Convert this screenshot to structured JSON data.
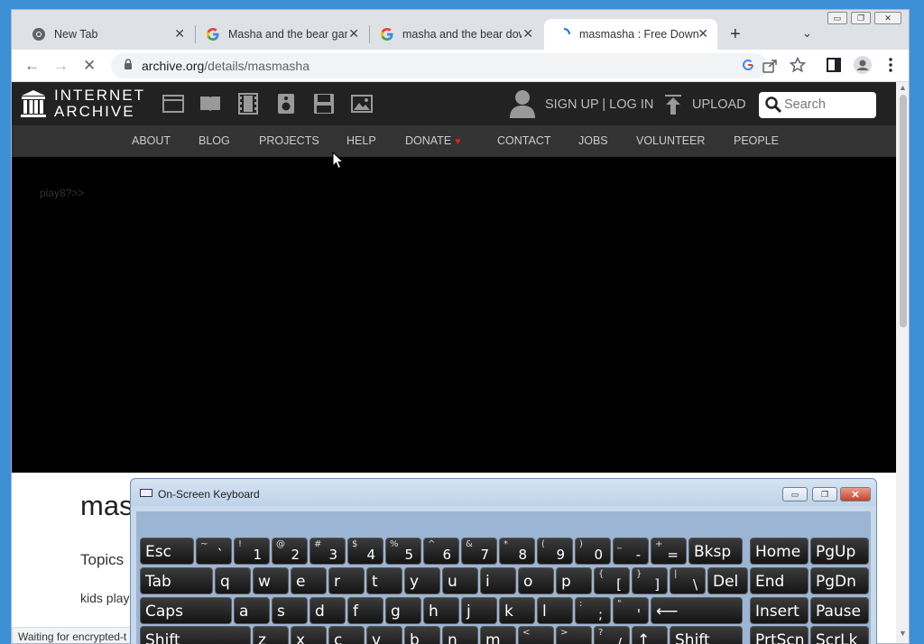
{
  "browser": {
    "tabs": [
      {
        "title": "New Tab",
        "icon": "chrome-icon",
        "active": false
      },
      {
        "title": "Masha and the bear gam",
        "icon": "google-icon",
        "active": false
      },
      {
        "title": "masha and the bear dow",
        "icon": "google-icon",
        "active": false
      },
      {
        "title": "masmasha : Free Downlo",
        "icon": "loading-icon",
        "active": true
      }
    ],
    "close_glyph": "✕",
    "new_tab_glyph": "+",
    "tab_search_glyph": "⌄",
    "window_controls": {
      "minimize": "▭",
      "restore": "❐",
      "close": "✕"
    },
    "nav": {
      "back": "←",
      "forward": "→",
      "stop": "✕"
    },
    "url_domain": "archive.org",
    "url_path": "/details/masmasha",
    "toolbar_icons": [
      "google-lens-icon",
      "share-icon",
      "star-icon",
      "sidepanel-icon",
      "profile-icon",
      "menu-icon"
    ]
  },
  "ia_header": {
    "wordmark_line1": "INTERNET",
    "wordmark_line2": "ARCHIVE",
    "media_icons": [
      "web-icon",
      "texts-icon",
      "video-icon",
      "audio-icon",
      "software-icon",
      "images-icon"
    ],
    "signup_login": "SIGN UP | LOG IN",
    "upload": "UPLOAD",
    "search_placeholder": "Search"
  },
  "ia_nav": {
    "items": [
      "ABOUT",
      "BLOG",
      "PROJECTS",
      "HELP",
      "DONATE",
      "CONTACT",
      "JOBS",
      "VOLUNTEER",
      "PEOPLE"
    ],
    "donate_heart": "♥"
  },
  "player": {
    "text": "play8?>>"
  },
  "item": {
    "title": "mas",
    "topics_label": "Topics",
    "topics_value": "kids play"
  },
  "status_bar": {
    "text": "Waiting for encrypted-t"
  },
  "osk": {
    "title": "On-Screen Keyboard",
    "controls": {
      "minimize": "▭",
      "restore": "❐",
      "close": "✕"
    },
    "rows": [
      [
        {
          "main": "Esc"
        },
        {
          "shift": "~",
          "low": "`"
        },
        {
          "shift": "!",
          "low": "1"
        },
        {
          "shift": "@",
          "low": "2"
        },
        {
          "shift": "#",
          "low": "3"
        },
        {
          "shift": "$",
          "low": "4"
        },
        {
          "shift": "%",
          "low": "5"
        },
        {
          "shift": "^",
          "low": "6"
        },
        {
          "shift": "&",
          "low": "7"
        },
        {
          "shift": "*",
          "low": "8"
        },
        {
          "shift": "(",
          "low": "9"
        },
        {
          "shift": ")",
          "low": "0"
        },
        {
          "shift": "_",
          "low": "-"
        },
        {
          "shift": "+",
          "low": "="
        },
        {
          "main": "Bksp"
        },
        {
          "main": "Home"
        },
        {
          "main": "PgUp"
        }
      ],
      [
        {
          "main": "Tab"
        },
        {
          "main": "q"
        },
        {
          "main": "w"
        },
        {
          "main": "e"
        },
        {
          "main": "r"
        },
        {
          "main": "t"
        },
        {
          "main": "y"
        },
        {
          "main": "u"
        },
        {
          "main": "i"
        },
        {
          "main": "o"
        },
        {
          "main": "p"
        },
        {
          "shift": "{",
          "low": "["
        },
        {
          "shift": "}",
          "low": "]"
        },
        {
          "shift": "|",
          "low": "\\"
        },
        {
          "main": "Del"
        },
        {
          "main": "End"
        },
        {
          "main": "PgDn"
        }
      ],
      [
        {
          "main": "Caps"
        },
        {
          "main": "a"
        },
        {
          "main": "s"
        },
        {
          "main": "d"
        },
        {
          "main": "f"
        },
        {
          "main": "g"
        },
        {
          "main": "h"
        },
        {
          "main": "j"
        },
        {
          "main": "k"
        },
        {
          "main": "l"
        },
        {
          "shift": ":",
          "low": ";"
        },
        {
          "shift": "\"",
          "low": "'"
        },
        {
          "main": "⟵"
        },
        {
          "main": "Insert"
        },
        {
          "main": "Pause"
        }
      ],
      [
        {
          "main": "Shift"
        },
        {
          "main": "z"
        },
        {
          "main": "x"
        },
        {
          "main": "c"
        },
        {
          "main": "v"
        },
        {
          "main": "b"
        },
        {
          "main": "n"
        },
        {
          "main": "m"
        },
        {
          "shift": "<",
          "low": ","
        },
        {
          "shift": ">",
          "low": "."
        },
        {
          "shift": "?",
          "low": "/"
        },
        {
          "main": "↑"
        },
        {
          "main": "Shift"
        },
        {
          "main": "PrtScn"
        },
        {
          "main": "ScrLk"
        }
      ]
    ]
  }
}
